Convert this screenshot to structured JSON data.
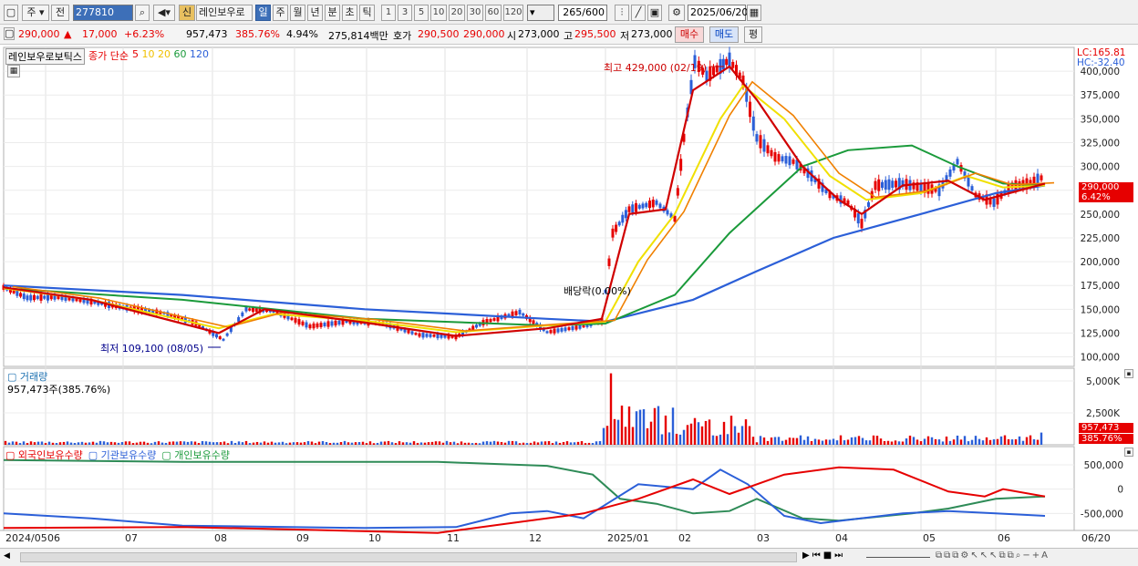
{
  "toolbar": {
    "period": "주",
    "type": "전",
    "code": "277810",
    "badge": "신",
    "name": "레인보우로",
    "periods": [
      "일",
      "주",
      "월",
      "년",
      "분",
      "초",
      "틱"
    ],
    "intervals": [
      "1",
      "3",
      "5",
      "10",
      "20",
      "30",
      "60",
      "120"
    ],
    "count": "265",
    "count_total": "/600",
    "date": "2025/06/20"
  },
  "info": {
    "price": "290,000",
    "arrow": "▲",
    "change": "17,000",
    "pct": "+6.23%",
    "volume": "957,473",
    "vol_pct": "385.76%",
    "turnover": "4.94%",
    "amount": "275,814백만",
    "hoga_label": "호가",
    "hoga1": "290,500",
    "hoga2": "290,000",
    "open_label": "시",
    "open": "273,000",
    "high_label": "고",
    "high": "295,500",
    "low_label": "저",
    "low": "273,000",
    "buy": "매수",
    "sell": "매도",
    "eval": "평"
  },
  "price_panel": {
    "title": "레인보우로보틱스",
    "legend_label": "종가 단순",
    "ma": [
      {
        "period": "5",
        "color": "#e60000"
      },
      {
        "period": "10",
        "color": "#f0c000"
      },
      {
        "period": "20",
        "color": "#f0c000"
      },
      {
        "period": "60",
        "color": "#1a9a3a"
      },
      {
        "period": "120",
        "color": "#2b5fd8"
      }
    ],
    "lc": "LC:165.81",
    "hc": "HC:-32.40",
    "high_note": "최고 429,000 (02/19)",
    "low_note": "최저 109,100 (08/05)",
    "div_note": "배당락(0.00%)",
    "last_price": "290,000",
    "last_pct": "6.42%"
  },
  "volume_panel": {
    "title": "거래량",
    "note": "957,473주(385.76%)",
    "last": "957,473",
    "last_pct": "385.76%"
  },
  "holding_panel": {
    "t1": "외국인보유수량",
    "t2": "기관보유수량",
    "t3": "개인보유수량"
  },
  "xaxis": {
    "labels": [
      "2024/05",
      "06",
      "07",
      "08",
      "09",
      "10",
      "11",
      "12",
      "2025/01",
      "02",
      "03",
      "04",
      "05",
      "06",
      "06/20"
    ]
  },
  "chart_data": [
    {
      "type": "line",
      "title": "레인보우로보틱스",
      "x": [
        "2024/05",
        "2024/06",
        "2024/07",
        "2024/08",
        "2024/09",
        "2024/10",
        "2024/11",
        "2024/12",
        "2025/01",
        "2025/02",
        "2025/03",
        "2025/04",
        "2025/05",
        "2025/06",
        "2025/06/20"
      ],
      "series": [
        {
          "name": "종가",
          "values": [
            173000,
            158000,
            152000,
            120000,
            142000,
            137000,
            122000,
            138000,
            135000,
            395000,
            320000,
            255000,
            275000,
            270000,
            290000
          ]
        },
        {
          "name": "5",
          "values": [
            172000,
            160000,
            150000,
            125000,
            140000,
            136000,
            124000,
            137000,
            140000,
            395000,
            330000,
            265000,
            280000,
            270000,
            282000
          ]
        },
        {
          "name": "60",
          "values": [
            172000,
            168000,
            160000,
            150000,
            145000,
            140000,
            135000,
            133000,
            135000,
            180000,
            270000,
            315000,
            300000,
            275000,
            280000
          ]
        },
        {
          "name": "120",
          "values": [
            175000,
            172000,
            168000,
            160000,
            155000,
            150000,
            145000,
            140000,
            137000,
            155000,
            190000,
            225000,
            250000,
            270000,
            280000
          ]
        }
      ],
      "ylim": [
        90000,
        425000
      ],
      "yticks": [
        "400,000",
        "375,000",
        "350,000",
        "325,000",
        "300,000",
        "275,000",
        "250,000",
        "225,000",
        "200,000",
        "175,000",
        "150,000",
        "125,000",
        "100,000"
      ]
    },
    {
      "type": "bar",
      "title": "거래량",
      "yticks": [
        "5,000K",
        "2,500K"
      ],
      "ylim": [
        0,
        6000000
      ]
    },
    {
      "type": "line",
      "title": "보유수량",
      "yticks": [
        "500,000",
        "0",
        "-500,000"
      ],
      "series": [
        {
          "name": "외국인보유수량"
        },
        {
          "name": "기관보유수량"
        },
        {
          "name": "개인보유수량"
        }
      ]
    }
  ]
}
